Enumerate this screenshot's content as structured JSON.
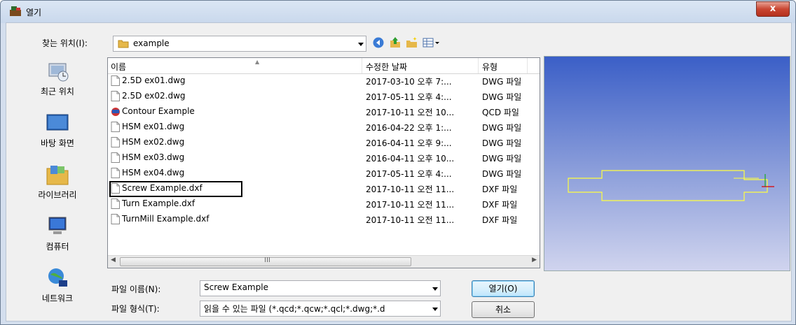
{
  "window": {
    "title": "열기",
    "close_label": "x"
  },
  "toolbar": {
    "lookin_label": "찾는 위치(I):",
    "lookin_value": "example",
    "icons": [
      "back-icon",
      "up-folder-icon",
      "new-folder-icon",
      "view-menu-icon"
    ]
  },
  "places": [
    {
      "label": "최근 위치",
      "icon": "recent-places-icon"
    },
    {
      "label": "바탕 화면",
      "icon": "desktop-icon"
    },
    {
      "label": "라이브러리",
      "icon": "libraries-icon"
    },
    {
      "label": "컴퓨터",
      "icon": "computer-icon"
    },
    {
      "label": "네트워크",
      "icon": "network-icon"
    }
  ],
  "list": {
    "columns": [
      "이름",
      "수정한 날짜",
      "유형"
    ],
    "rows": [
      {
        "name": "2.5D ex01.dwg",
        "date": "2017-03-10 오후 7:...",
        "type": "DWG 파일",
        "icon": "file-icon"
      },
      {
        "name": "2.5D ex02.dwg",
        "date": "2017-05-11 오후 4:...",
        "type": "DWG 파일",
        "icon": "file-icon"
      },
      {
        "name": "Contour Example",
        "date": "2017-10-11 오전 10...",
        "type": "QCD 파일",
        "icon": "qcd-file-icon"
      },
      {
        "name": "HSM ex01.dwg",
        "date": "2016-04-22 오후 1:...",
        "type": "DWG 파일",
        "icon": "file-icon"
      },
      {
        "name": "HSM ex02.dwg",
        "date": "2016-04-11 오후 9:...",
        "type": "DWG 파일",
        "icon": "file-icon"
      },
      {
        "name": "HSM ex03.dwg",
        "date": "2016-04-11 오후 10...",
        "type": "DWG 파일",
        "icon": "file-icon"
      },
      {
        "name": "HSM ex04.dwg",
        "date": "2017-05-11 오후 4:...",
        "type": "DWG 파일",
        "icon": "file-icon"
      },
      {
        "name": "Screw Example.dxf",
        "date": "2017-10-11 오전 11...",
        "type": "DXF 파일",
        "icon": "file-icon",
        "highlighted": true
      },
      {
        "name": "Turn Example.dxf",
        "date": "2017-10-11 오전 11...",
        "type": "DXF 파일",
        "icon": "file-icon"
      },
      {
        "name": "TurnMill Example.dxf",
        "date": "2017-10-11 오전 11...",
        "type": "DXF 파일",
        "icon": "file-icon"
      }
    ],
    "scroll_grip": "III"
  },
  "bottom": {
    "filename_label": "파일 이름(N):",
    "filename_value": "Screw Example",
    "filetype_label": "파일 형식(T):",
    "filetype_value": "읽을 수 있는 파일 (*.qcd;*.qcw;*.qcl;*.dwg;*.d",
    "open_label": "열기(O)",
    "cancel_label": "취소"
  },
  "colors": {
    "preview_bg": "#5a78d0",
    "preview_outline": "#ffff40",
    "highlight_box": "#000000"
  }
}
